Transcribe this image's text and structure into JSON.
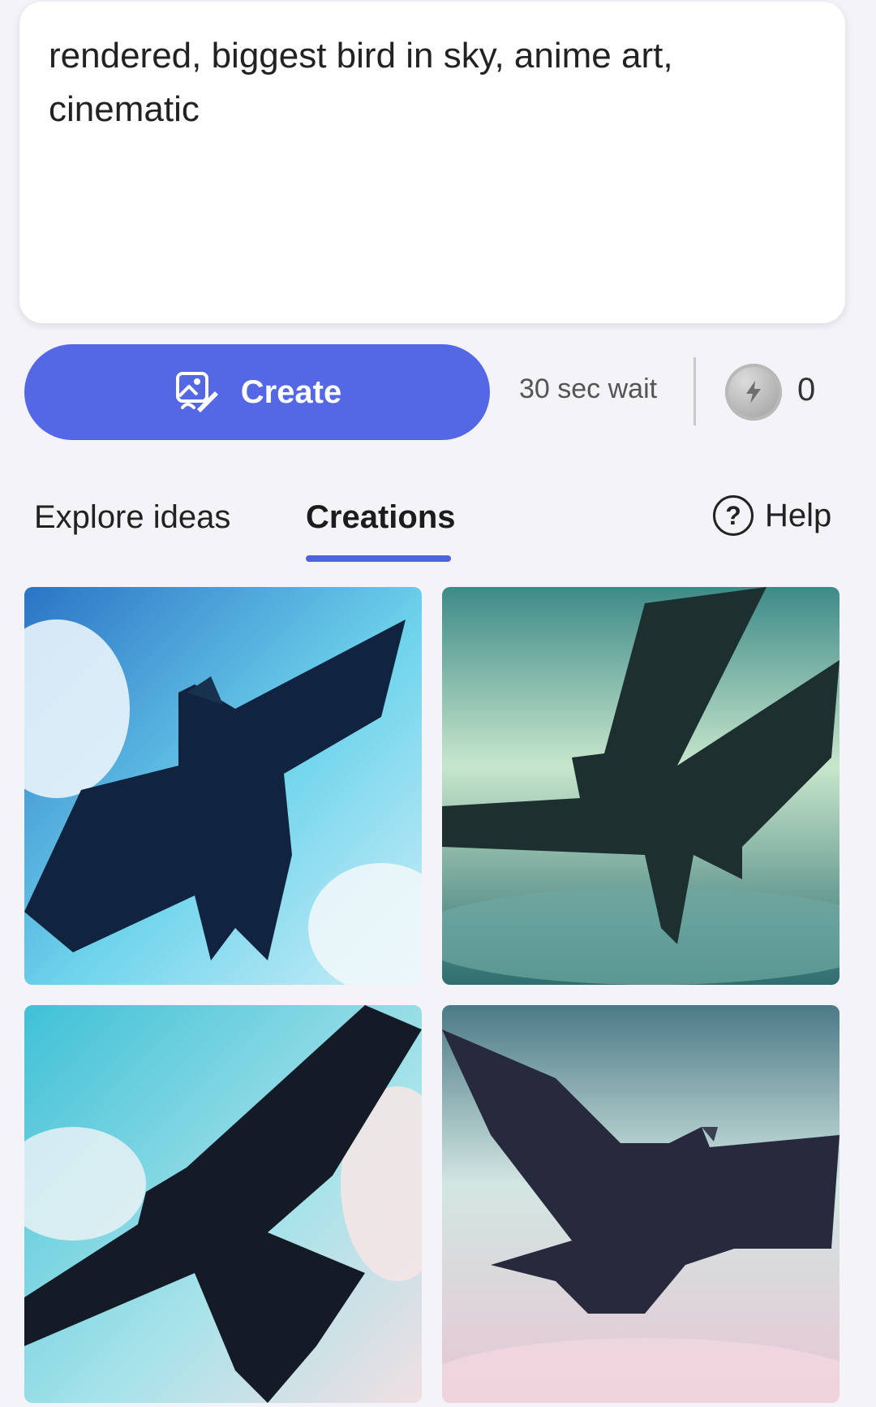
{
  "prompt": {
    "text": "rendered, biggest bird in sky, anime art, cinematic"
  },
  "actions": {
    "create_label": "Create",
    "wait_text": "30 sec wait",
    "boost_count": "0"
  },
  "tabs": {
    "explore_label": "Explore ideas",
    "creations_label": "Creations",
    "help_label": "Help",
    "active": "Creations"
  },
  "colors": {
    "accent": "#5467e4",
    "tab_underline": "#4c62de",
    "background": "#f4f3f8"
  },
  "icons": [
    "create-image-icon",
    "boost-coin-icon",
    "help-circle-icon"
  ],
  "creations": [
    {
      "name": "bird-image-1"
    },
    {
      "name": "bird-image-2"
    },
    {
      "name": "bird-image-3"
    },
    {
      "name": "bird-image-4"
    }
  ]
}
